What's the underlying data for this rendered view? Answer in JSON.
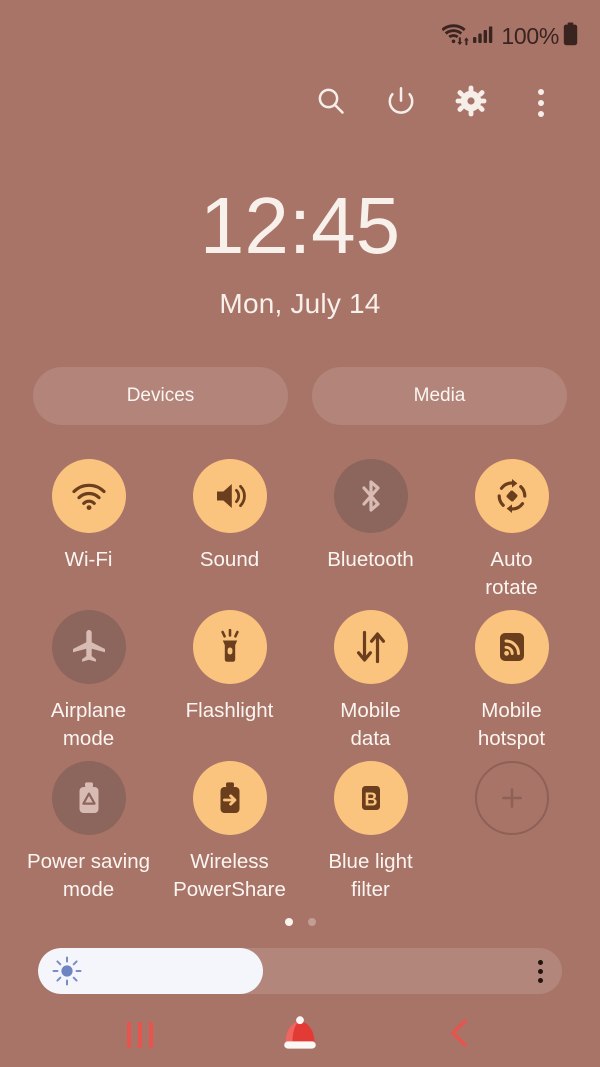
{
  "status_bar": {
    "wifi_icon": "wifi-transfer-icon",
    "signal_icon": "cellular-signal-icon",
    "battery_percent": "100%",
    "battery_icon": "battery-full-icon"
  },
  "toolbar": {
    "buttons": [
      {
        "name": "search-button",
        "icon": "search-icon"
      },
      {
        "name": "power-button",
        "icon": "power-icon"
      },
      {
        "name": "settings-button",
        "icon": "gear-icon"
      },
      {
        "name": "more-options-button",
        "icon": "overflow-menu-icon"
      }
    ]
  },
  "clock": {
    "time": "12:45",
    "date": "Mon, July 14"
  },
  "shortcuts": {
    "devices_label": "Devices",
    "media_label": "Media"
  },
  "quick_settings": {
    "tiles": [
      {
        "label": "Wi-Fi",
        "icon": "wifi-icon",
        "state": "on"
      },
      {
        "label": "Sound",
        "icon": "speaker-icon",
        "state": "on"
      },
      {
        "label": "Bluetooth",
        "icon": "bluetooth-icon",
        "state": "off"
      },
      {
        "label": "Auto\nrotate",
        "icon": "auto-rotate-icon",
        "state": "on"
      },
      {
        "label": "Airplane\nmode",
        "icon": "airplane-icon",
        "state": "off"
      },
      {
        "label": "Flashlight",
        "icon": "flashlight-icon",
        "state": "on"
      },
      {
        "label": "Mobile\ndata",
        "icon": "data-transfer-icon",
        "state": "on"
      },
      {
        "label": "Mobile\nhotspot",
        "icon": "hotspot-icon",
        "state": "on"
      },
      {
        "label": "Power saving\nmode",
        "icon": "power-saving-icon",
        "state": "off"
      },
      {
        "label": "Wireless\nPowerShare",
        "icon": "power-share-icon",
        "state": "on"
      },
      {
        "label": "Blue light\nfilter",
        "icon": "blue-light-icon",
        "state": "on"
      },
      {
        "label": "",
        "icon": "plus-icon",
        "state": "add"
      }
    ],
    "page_dots": {
      "total": 2,
      "active_index": 0
    }
  },
  "brightness": {
    "icon": "brightness-sun-icon",
    "level_percent": 43,
    "menu_icon": "overflow-menu-icon"
  },
  "nav_bar": {
    "recents_label": "recents-button",
    "home_label": "home-button-santa-hat",
    "back_label": "back-button"
  },
  "colors": {
    "background": "#a87468",
    "tile_on": "#fac37e",
    "tile_off": "#8c655c",
    "icon_on": "#6b3f1d",
    "text": "#fbf5f1",
    "nav_accent": "#e8544d",
    "santa_red": "#e23b35"
  }
}
